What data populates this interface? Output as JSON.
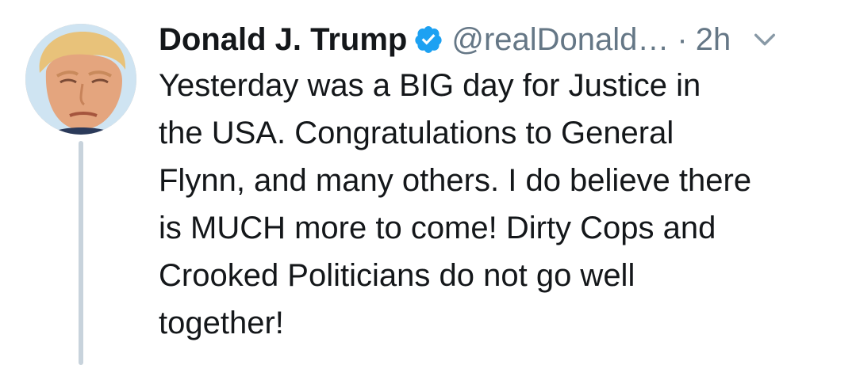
{
  "author": {
    "display_name": "Donald J. Trump",
    "handle": "@realDonald…",
    "verified": true,
    "avatar_icon": "profile-photo"
  },
  "meta": {
    "separator": "·",
    "timestamp": "2h",
    "menu_icon": "chevron-down-icon"
  },
  "tweet": {
    "lines": [
      "Yesterday was a BIG day for Justice in",
      "the USA. Congratulations to General",
      "Flynn, and many others. I do believe there",
      "is MUCH more to come! Dirty Cops and",
      "Crooked Politicians do not go well",
      "together!"
    ]
  },
  "colors": {
    "text": "#14171a",
    "muted": "#657786",
    "verified_blue": "#1da1f2",
    "thread_line": "#c8d3dc"
  }
}
